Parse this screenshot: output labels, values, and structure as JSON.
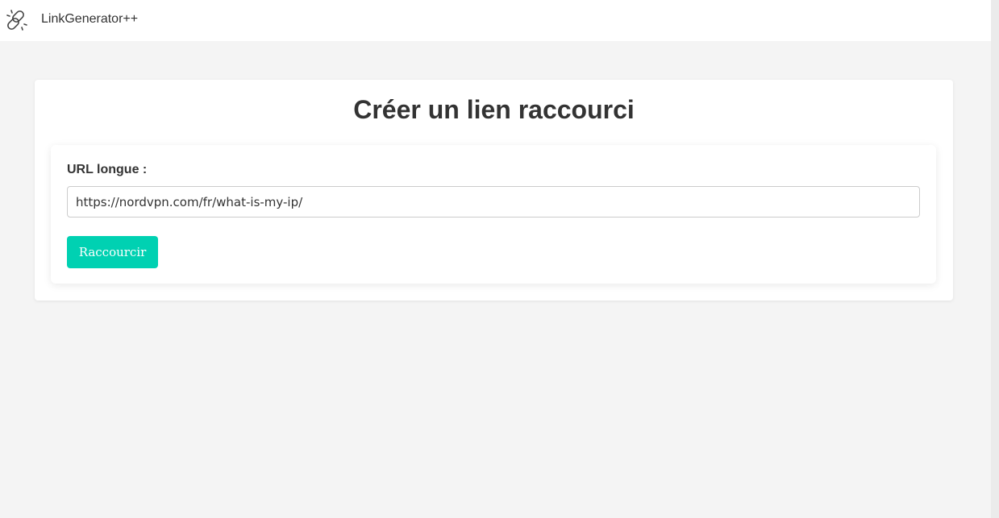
{
  "header": {
    "brand": "LinkGenerator++",
    "logo_icon": "link-chain-icon"
  },
  "main": {
    "title": "Créer un lien raccourci",
    "form": {
      "url_label": "URL longue :",
      "url_value": "https://nordvpn.com/fr/what-is-my-ip/",
      "submit_label": "Raccourcir"
    }
  },
  "colors": {
    "accent": "#00d1b2",
    "background": "#f4f4f4",
    "card": "#ffffff",
    "text": "#333333"
  }
}
